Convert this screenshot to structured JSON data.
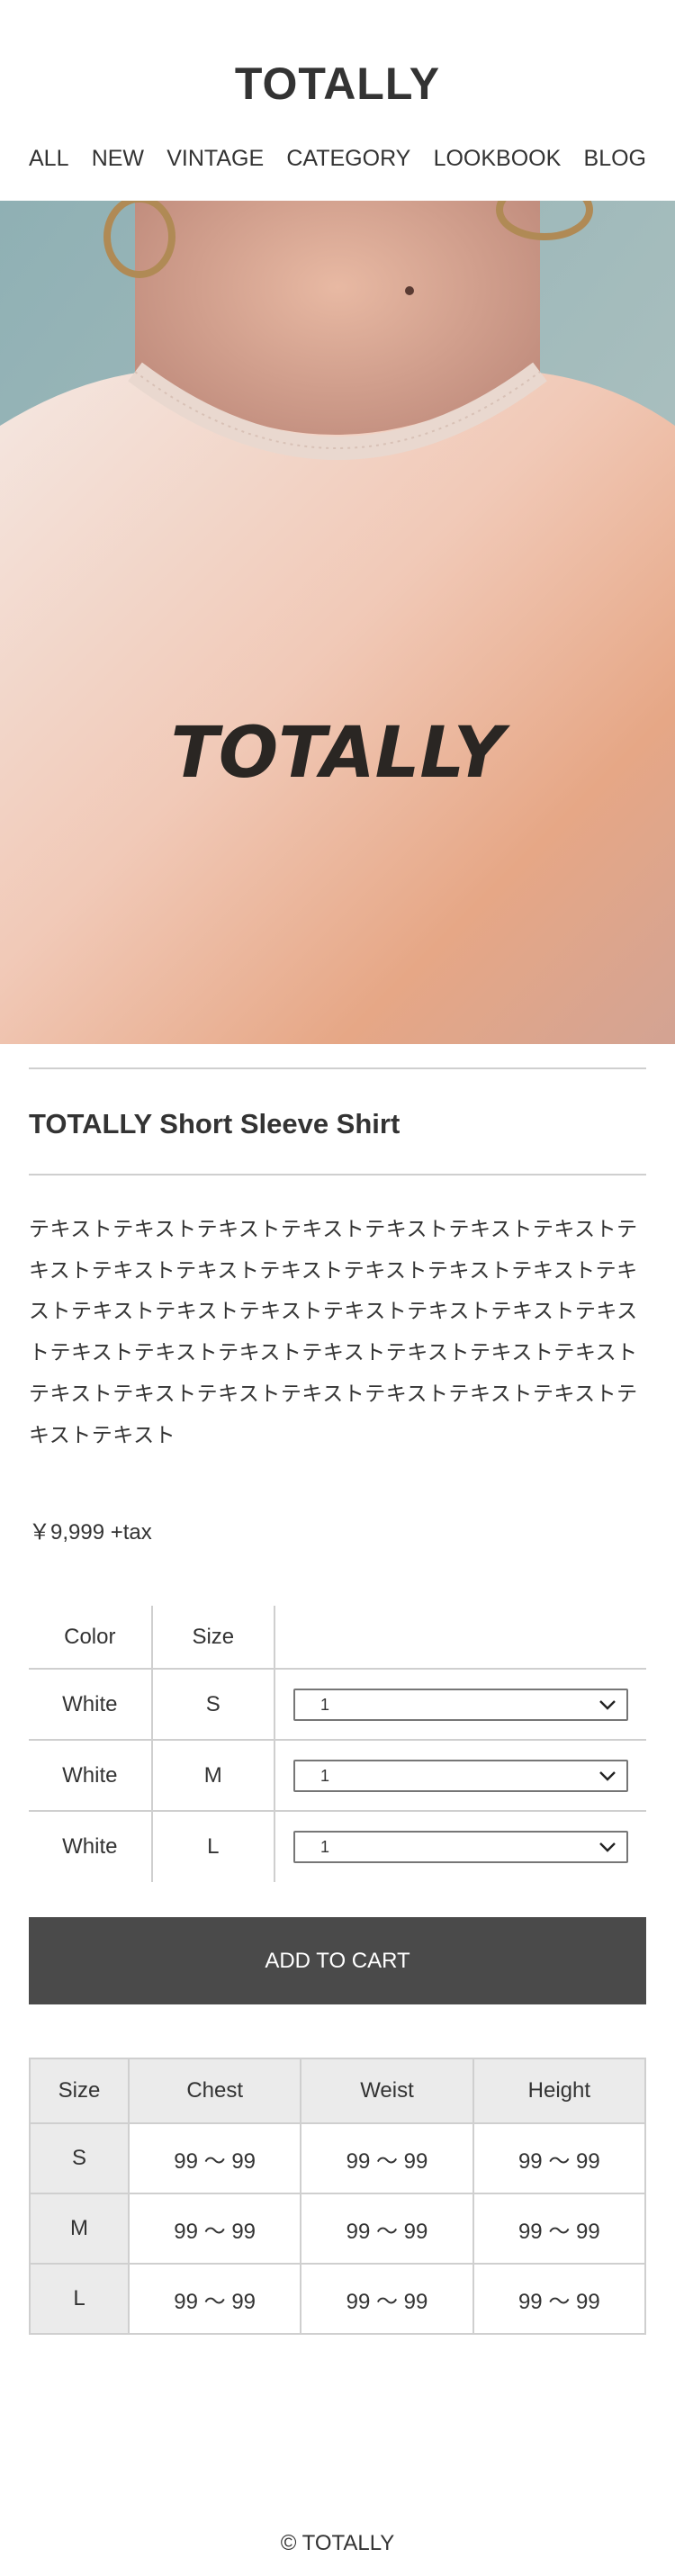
{
  "header": {
    "logo": "TOTALLY"
  },
  "nav": {
    "items": [
      "ALL",
      "NEW",
      "VINTAGE",
      "CATEGORY",
      "LOOKBOOK",
      "BLOG"
    ]
  },
  "hero": {
    "image": "shirt-photo",
    "shirt_print": "TOTALLY"
  },
  "product": {
    "title": "TOTALLY Short Sleeve Shirt",
    "description": "テキストテキストテキストテキストテキストテキストテキストテキストテキストテキストテキストテキストテキストテキストテキストテキストテキストテキストテキストテキストテキストテキストテキストテキストテキストテキストテキストテキストテキストテキストテキストテキストテキストテキストテキストテキストテキストテキスト",
    "price": "￥9,999 +tax"
  },
  "variants": {
    "headers": {
      "color": "Color",
      "size": "Size"
    },
    "rows": [
      {
        "color": "White",
        "size": "S",
        "qty": "1"
      },
      {
        "color": "White",
        "size": "M",
        "qty": "1"
      },
      {
        "color": "White",
        "size": "L",
        "qty": "1"
      }
    ]
  },
  "cart": {
    "button_label": "ADD TO CART"
  },
  "size_chart": {
    "headers": [
      "Size",
      "Chest",
      "Weist",
      "Height"
    ],
    "rows": [
      {
        "size": "S",
        "chest": "99 〜 99",
        "weist": "99 〜 99",
        "height": "99 〜 99"
      },
      {
        "size": "M",
        "chest": "99 〜 99",
        "weist": "99 〜 99",
        "height": "99 〜 99"
      },
      {
        "size": "L",
        "chest": "99 〜 99",
        "weist": "99 〜 99",
        "height": "99 〜 99"
      }
    ]
  },
  "footer": {
    "copyright": "© TOTALLY"
  },
  "colors": {
    "button_bg": "#4a4a4a",
    "divider": "#cfcfcf",
    "table_header_bg": "#ebebeb",
    "text": "#333333"
  }
}
